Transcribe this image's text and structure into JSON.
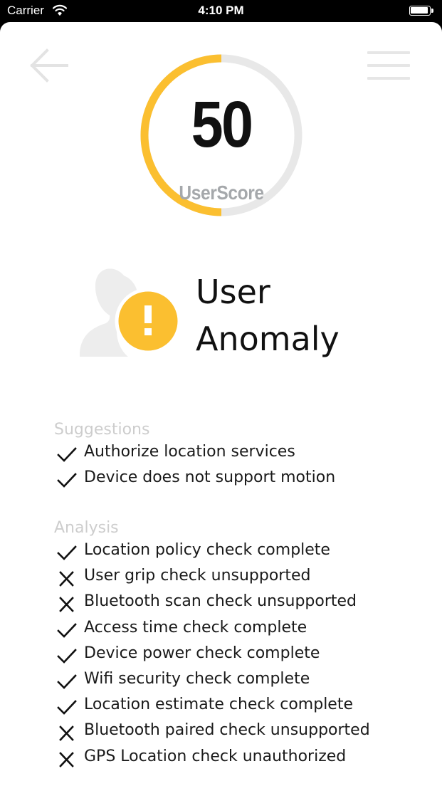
{
  "status_bar": {
    "carrier": "Carrier",
    "time": "4:10 PM"
  },
  "nav": {
    "back_icon": "arrow-left-icon",
    "menu_icon": "hamburger-menu-icon"
  },
  "score": {
    "value": "50",
    "label": "UserScore",
    "fraction": 0.5,
    "progress_color": "#fbbf30",
    "track_color": "#e8e8e8"
  },
  "status": {
    "title_line1": "User",
    "title_line2": "Anomaly",
    "icon": "user-warning-icon",
    "badge_color": "#fbbf30"
  },
  "suggestions": {
    "title": "Suggestions",
    "items": [
      {
        "label": "Authorize location services",
        "status": "check"
      },
      {
        "label": "Device does not support motion",
        "status": "check"
      }
    ]
  },
  "analysis": {
    "title": "Analysis",
    "items": [
      {
        "label": "Location policy check complete",
        "status": "check"
      },
      {
        "label": "User grip check unsupported",
        "status": "cross"
      },
      {
        "label": "Bluetooth scan check unsupported",
        "status": "cross"
      },
      {
        "label": "Access time check complete",
        "status": "check"
      },
      {
        "label": "Device power check complete",
        "status": "check"
      },
      {
        "label": "Wifi security check complete",
        "status": "check"
      },
      {
        "label": "Location estimate check complete",
        "status": "check"
      },
      {
        "label": "Bluetooth paired check unsupported",
        "status": "cross"
      },
      {
        "label": "GPS Location check unauthorized",
        "status": "cross"
      }
    ]
  }
}
